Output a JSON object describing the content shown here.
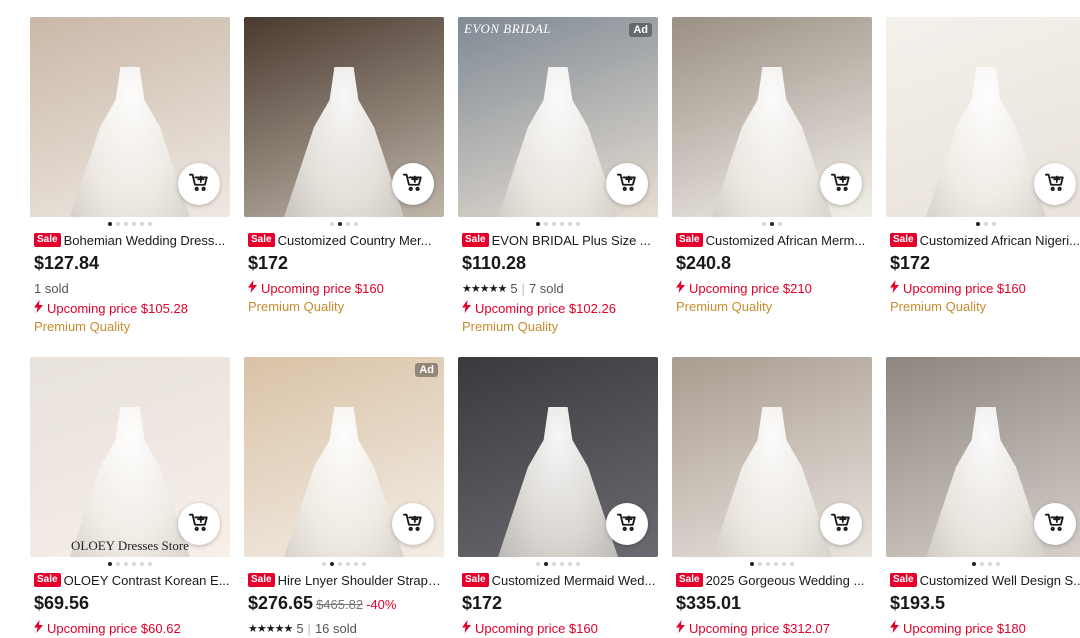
{
  "products": [
    {
      "title": "Bohemian Wedding Dress...",
      "price": "$127.84",
      "sold": "1 sold",
      "upcoming": "Upcoming price $105.28",
      "premium": "Premium Quality",
      "colors": [
        "#c9b8a8",
        "#efe9e2"
      ],
      "dots": 6,
      "activeDot": 0
    },
    {
      "title": "Customized Country Mer...",
      "price": "$172",
      "upcoming": "Upcoming price $160",
      "premium": "Premium Quality",
      "colors": [
        "#4a3a30",
        "#bfb6aa"
      ],
      "dots": 4,
      "activeDot": 1
    },
    {
      "title": "EVON BRIDAL Plus Size ...",
      "price": "$110.28",
      "rating": "5",
      "sold": "7 sold",
      "upcoming": "Upcoming price $102.26",
      "premium": "Premium Quality",
      "ad": "Ad",
      "watermark": "EVON BRIDAL",
      "colors": [
        "#7f8a94",
        "#e7ddd2"
      ],
      "dots": 6,
      "activeDot": 0
    },
    {
      "title": "Customized African Merm...",
      "price": "$240.8",
      "upcoming": "Upcoming price $210",
      "premium": "Premium Quality",
      "colors": [
        "#9a8f84",
        "#f2efe9"
      ],
      "dots": 3,
      "activeDot": 1
    },
    {
      "title": "Customized African Nigeri...",
      "price": "$172",
      "upcoming": "Upcoming price $160",
      "premium": "Premium Quality",
      "colors": [
        "#f4f1ec",
        "#e8e2da"
      ],
      "dots": 3,
      "activeDot": 0
    },
    {
      "title": "OLOEY Contrast Korean E...",
      "price": "$69.56",
      "upcoming": "Upcoming price $60.62",
      "store": "OLOEY Dresses Store",
      "colors": [
        "#e8e2dc",
        "#f7efe8"
      ],
      "dots": 6,
      "activeDot": 0
    },
    {
      "title": "Hire Lnyer Shoulder Straps...",
      "price": "$276.65",
      "oldPrice": "$465.82",
      "discount": "-40%",
      "rating": "5",
      "sold": "16 sold",
      "ad": "Ad",
      "colors": [
        "#d9c2a6",
        "#f3ede5"
      ],
      "dots": 6,
      "activeDot": 1
    },
    {
      "title": "Customized Mermaid Wed...",
      "price": "$172",
      "upcoming": "Upcoming price $160",
      "colors": [
        "#3a3a3e",
        "#6a6a70"
      ],
      "dots": 6,
      "activeDot": 1
    },
    {
      "title": "2025 Gorgeous Wedding ...",
      "price": "$335.01",
      "upcoming": "Upcoming price $312.07",
      "colors": [
        "#a99c90",
        "#e9e4de"
      ],
      "dots": 6,
      "activeDot": 0
    },
    {
      "title": "Customized Well Design S...",
      "price": "$193.5",
      "upcoming": "Upcoming price $180",
      "colors": [
        "#8d8680",
        "#d6d0c9"
      ],
      "dots": 4,
      "activeDot": 0
    }
  ],
  "labels": {
    "sale": "Sale"
  },
  "colors": {
    "sale": "#e4002b",
    "premium": "#c88b2e",
    "accent": "#e4002b"
  }
}
